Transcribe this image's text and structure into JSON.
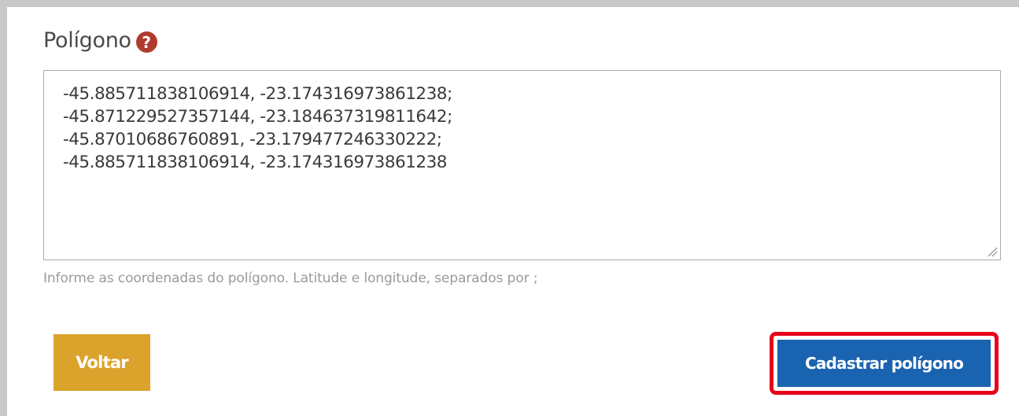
{
  "form": {
    "polygon_label": "Polígono",
    "help_icon_glyph": "?",
    "coordinates_value": "-45.885711838106914, -23.174316973861238;\n-45.871229527357144, -23.184637319811642;\n-45.87010686760891, -23.179477246330222;\n-45.885711838106914, -23.174316973861238",
    "hint": "Informe as coordenadas do polígono. Latitude e longitude, separados por ;"
  },
  "actions": {
    "back_label": "Voltar",
    "submit_label": "Cadastrar polígono"
  },
  "colors": {
    "back_button": "#dba32b",
    "submit_button": "#1a63b0",
    "help_icon": "#b03a2e",
    "highlight_outline": "#e8001a"
  },
  "icons": {
    "help": "question-circle-icon",
    "resize": "resize-handle-icon"
  }
}
